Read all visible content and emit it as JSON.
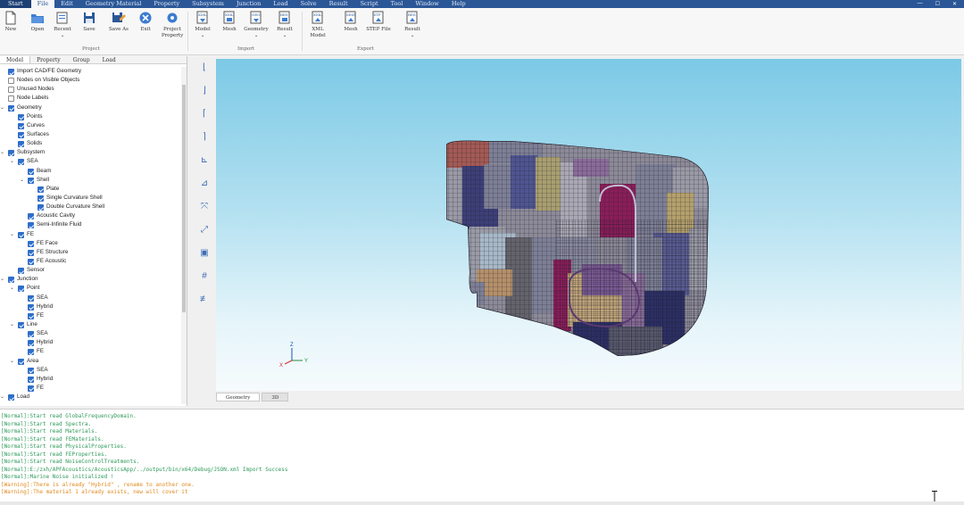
{
  "menubar": {
    "app": "Start",
    "items": [
      "File",
      "Edit",
      "Geometry Material",
      "Property",
      "Subsystem",
      "Junction",
      "Load",
      "Solve",
      "Result",
      "Script",
      "Tool",
      "Window",
      "Help"
    ],
    "active_index": 0
  },
  "ribbon": {
    "buttons": [
      {
        "label": "New",
        "icon": "new-file-icon"
      },
      {
        "label": "Open",
        "icon": "open-folder-icon"
      },
      {
        "label": "Recent",
        "icon": "recent-files-icon",
        "dropdown": "⌄"
      },
      {
        "label": "Save",
        "icon": "save-icon"
      },
      {
        "label": "Save As",
        "icon": "save-as-icon"
      },
      {
        "label": "Exit",
        "icon": "exit-icon"
      },
      {
        "label": "Project Property",
        "icon": "project-property-gear-icon"
      },
      {
        "label": "Model",
        "icon": "import-model-icon",
        "dropdown": "⌄"
      },
      {
        "label": "Mesh",
        "icon": "import-mesh-icon"
      },
      {
        "label": "Geometry",
        "icon": "import-geometry-icon",
        "dropdown": "⌄"
      },
      {
        "label": "Result",
        "icon": "import-result-icon",
        "dropdown": "⌄"
      },
      {
        "label": "XML Model",
        "icon": "export-xml-model-icon"
      },
      {
        "label": "Mesh",
        "icon": "export-mesh-icon"
      },
      {
        "label": "STEP File",
        "icon": "export-step-file-icon"
      },
      {
        "label": "Result",
        "icon": "export-result-icon",
        "dropdown": "⌄"
      }
    ],
    "groups": [
      "Project",
      "Import",
      "Export"
    ]
  },
  "panel": {
    "tabs": [
      "Model",
      "Property",
      "Group",
      "Load"
    ],
    "tree": [
      {
        "label": "Import CAD/FE Geometry",
        "level": 0,
        "arrow": "",
        "checked": true
      },
      {
        "label": "Nodes on Visible Objects",
        "level": 0,
        "arrow": "",
        "checked": false
      },
      {
        "label": "Unused Nodes",
        "level": 0,
        "arrow": "",
        "checked": false
      },
      {
        "label": "Node Labels",
        "level": 0,
        "arrow": "",
        "checked": false
      },
      {
        "label": "Geometry",
        "level": 0,
        "arrow": "⌄",
        "checked": true
      },
      {
        "label": "Points",
        "level": 1,
        "arrow": "",
        "checked": true
      },
      {
        "label": "Curves",
        "level": 1,
        "arrow": "",
        "checked": true
      },
      {
        "label": "Surfaces",
        "level": 1,
        "arrow": "",
        "checked": true
      },
      {
        "label": "Solids",
        "level": 1,
        "arrow": "",
        "checked": true
      },
      {
        "label": "Subsystem",
        "level": 0,
        "arrow": "⌄",
        "checked": true
      },
      {
        "label": "SEA",
        "level": 1,
        "arrow": "⌄",
        "checked": true
      },
      {
        "label": "Beam",
        "level": 2,
        "arrow": "",
        "checked": true
      },
      {
        "label": "Shell",
        "level": 2,
        "arrow": "⌄",
        "checked": true
      },
      {
        "label": "Plate",
        "level": 3,
        "arrow": "",
        "checked": true
      },
      {
        "label": "Single Curvature Shell",
        "level": 3,
        "arrow": "",
        "checked": true
      },
      {
        "label": "Double Curvature Shell",
        "level": 3,
        "arrow": "",
        "checked": true
      },
      {
        "label": "Acoustic Cavity",
        "level": 2,
        "arrow": "",
        "checked": true
      },
      {
        "label": "Semi-Infinite Fluid",
        "level": 2,
        "arrow": "",
        "checked": true
      },
      {
        "label": "FE",
        "level": 1,
        "arrow": "⌄",
        "checked": true
      },
      {
        "label": "FE Face",
        "level": 2,
        "arrow": "",
        "checked": true
      },
      {
        "label": "FE Structure",
        "level": 2,
        "arrow": "",
        "checked": true
      },
      {
        "label": "FE Acoustic",
        "level": 2,
        "arrow": "",
        "checked": true
      },
      {
        "label": "Sensor",
        "level": 1,
        "arrow": "",
        "checked": true
      },
      {
        "label": "Junction",
        "level": 0,
        "arrow": "⌄",
        "checked": true
      },
      {
        "label": "Point",
        "level": 1,
        "arrow": "⌄",
        "checked": true
      },
      {
        "label": "SEA",
        "level": 2,
        "arrow": "",
        "checked": true
      },
      {
        "label": "Hybrid",
        "level": 2,
        "arrow": "",
        "checked": true
      },
      {
        "label": "FE",
        "level": 2,
        "arrow": "",
        "checked": true
      },
      {
        "label": "Line",
        "level": 1,
        "arrow": "⌄",
        "checked": true
      },
      {
        "label": "SEA",
        "level": 2,
        "arrow": "",
        "checked": true
      },
      {
        "label": "Hybrid",
        "level": 2,
        "arrow": "",
        "checked": true
      },
      {
        "label": "FE",
        "level": 2,
        "arrow": "",
        "checked": true
      },
      {
        "label": "Area",
        "level": 1,
        "arrow": "⌄",
        "checked": true
      },
      {
        "label": "SEA",
        "level": 2,
        "arrow": "",
        "checked": true
      },
      {
        "label": "Hybrid",
        "level": 2,
        "arrow": "",
        "checked": true
      },
      {
        "label": "FE",
        "level": 2,
        "arrow": "",
        "checked": true
      },
      {
        "label": "Load",
        "level": 0,
        "arrow": "⌄",
        "checked": true
      }
    ]
  },
  "viewtools": [
    "view-front-icon",
    "view-back-icon",
    "view-top-icon",
    "view-bottom-icon",
    "view-left-icon",
    "view-right-icon",
    "view-isometric-icon",
    "fit-all-icon",
    "screenshot-icon",
    "grid-icon",
    "section-icon"
  ],
  "view_tabs": [
    "Geometry",
    "3D"
  ],
  "axis": {
    "x": "X",
    "y": "Y",
    "z": "Z"
  },
  "console": [
    {
      "text": "[Normal]:Start read GlobalFrequencyDomain.",
      "type": "info"
    },
    {
      "text": "[Normal]:Start read Spectra.",
      "type": "info"
    },
    {
      "text": "[Normal]:Start read Materials.",
      "type": "info"
    },
    {
      "text": "[Normal]:Start read FEMaterials.",
      "type": "info"
    },
    {
      "text": "[Normal]:Start read PhysicalProperties.",
      "type": "info"
    },
    {
      "text": "[Normal]:Start read FEProperties.",
      "type": "info"
    },
    {
      "text": "[Normal]:Start read NoiseControlTreatments.",
      "type": "info"
    },
    {
      "text": "[Normal]:E:/zxh/APFAcoustics/AcousticsApp/../output/bin/x64/Debug/JSON.xml Import Success",
      "type": "info"
    },
    {
      "text": "[Normal]:Marine Noise initialized !",
      "type": "info"
    },
    {
      "text": "[Warning]:There is already \"Hybrid\" , rename to another one.",
      "type": "warn"
    },
    {
      "text": "[Warning]:The material 1 already exists, new will cover it",
      "type": "warn"
    }
  ]
}
